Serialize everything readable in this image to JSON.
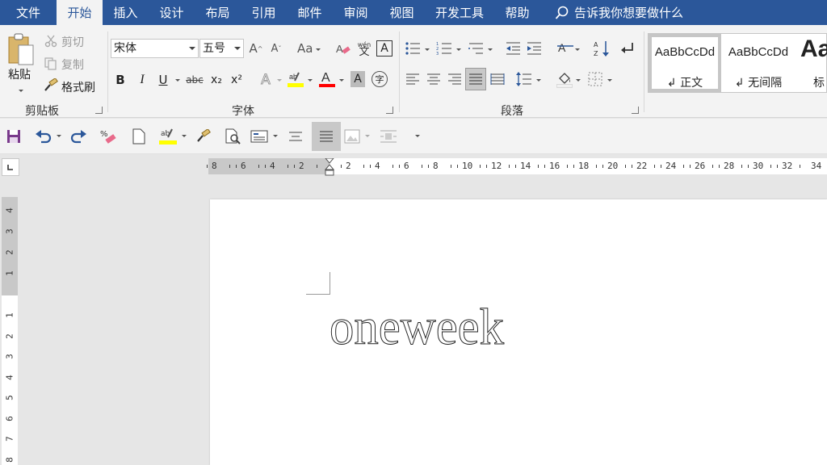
{
  "menu": {
    "tabs": [
      "文件",
      "开始",
      "插入",
      "设计",
      "布局",
      "引用",
      "邮件",
      "审阅",
      "视图",
      "开发工具",
      "帮助"
    ],
    "active_tab": "开始",
    "tell_me": "告诉我你想要做什么"
  },
  "clipboard": {
    "paste_label": "粘贴",
    "cut_label": "剪切",
    "copy_label": "复制",
    "format_painter_label": "格式刷",
    "group_label": "剪贴板"
  },
  "font": {
    "font_name": "宋体",
    "font_size": "五号",
    "case_label": "Aa",
    "group_label": "字体",
    "bold": "B",
    "italic": "I",
    "underline": "U",
    "strikethrough": "abc",
    "subscript": "x₂",
    "superscript": "x²",
    "highlight_color": "#ffff00",
    "font_color": "#ff0000"
  },
  "paragraph": {
    "group_label": "段落"
  },
  "styles": {
    "items": [
      {
        "sample": "AaBbCcDd",
        "name": "↲ 正文"
      },
      {
        "sample": "AaBbCcDd",
        "name": "↲ 无间隔"
      },
      {
        "sample": "Aa",
        "name": "标题"
      }
    ]
  },
  "ruler": {
    "h_numbers": [
      "8",
      "6",
      "4",
      "2",
      "2",
      "4",
      "6",
      "8",
      "10",
      "12",
      "14",
      "16",
      "18",
      "20",
      "22",
      "24",
      "26",
      "28",
      "30",
      "32",
      "34"
    ],
    "v_numbers": [
      "4",
      "3",
      "2",
      "1",
      "1",
      "2",
      "3",
      "4",
      "5",
      "6",
      "7",
      "8"
    ]
  },
  "document": {
    "text": "oneweek"
  },
  "colors": {
    "brand": "#2b579a"
  }
}
